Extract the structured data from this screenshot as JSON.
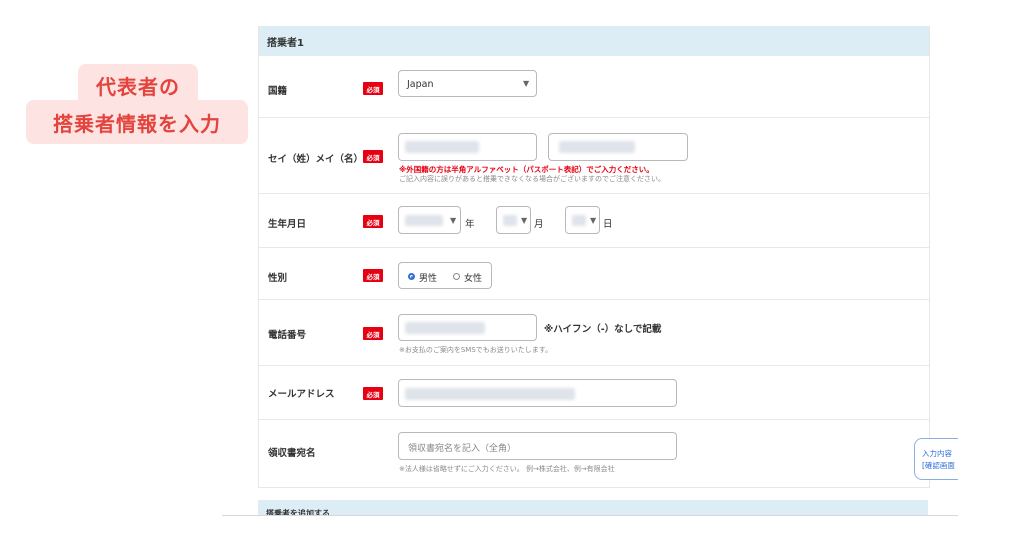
{
  "annotation": {
    "line1": "代表者の",
    "line2": "搭乗者情報を入力"
  },
  "section": {
    "title": "搭乗者1"
  },
  "required_badge": "必須",
  "fields": {
    "nationality": {
      "label": "国籍",
      "value": "Japan"
    },
    "name": {
      "label": "セイ（姓）メイ（名）",
      "warning": "※外国籍の方は半角アルファベット（パスポート表記）でご入力ください。",
      "help": "ご記入内容に誤りがあると搭乗できなくなる場合がございますのでご注意ください。"
    },
    "birthdate": {
      "label": "生年月日",
      "year_unit": "年",
      "month_unit": "月",
      "day_unit": "日"
    },
    "gender": {
      "label": "性別",
      "options": [
        "男性",
        "女性"
      ],
      "selected": "男性"
    },
    "phone": {
      "label": "電話番号",
      "note": "※ハイフン（-）なしで記載",
      "help": "※お支払のご案内をSMSでもお送りいたします。"
    },
    "email": {
      "label": "メールアドレス"
    },
    "receipt": {
      "label": "領収書宛名",
      "placeholder": "領収書宛名を記入（全角）",
      "help": "※法人様は省略せずにご入力ください。 例→株式会社、例→有限会社"
    }
  },
  "next_section": {
    "title": "搭乗者を追加する"
  },
  "side_tab": {
    "line1": "入力内容",
    "line2": "[確認画面"
  },
  "colors": {
    "accent_red": "#e60012",
    "header_blue": "#dcedf6",
    "annotation_bg": "#fde3e1",
    "annotation_text": "#e3443d"
  }
}
